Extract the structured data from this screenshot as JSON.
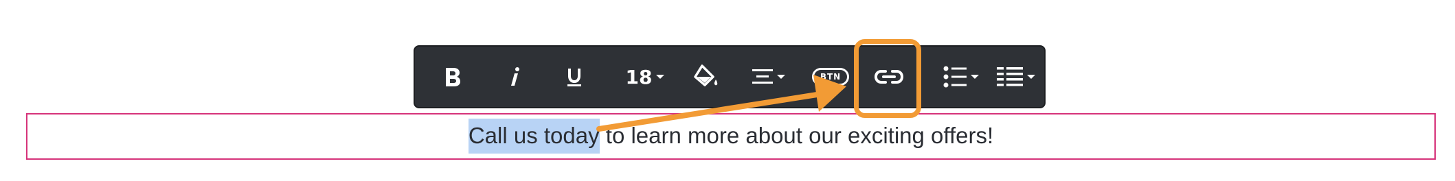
{
  "toolbar": {
    "bold_icon": "bold-icon",
    "italic_icon": "italic-icon",
    "underline_icon": "underline-icon",
    "font_size": "18",
    "fill_icon": "paint-bucket-icon",
    "align_icon": "align-center-icon",
    "button_label": "BTN",
    "link_icon": "link-icon",
    "bullet_list_icon": "bulleted-list-icon",
    "numbered_list_icon": "numbered-list-icon"
  },
  "content": {
    "selected_text": "Call us today",
    "rest_text": " to learn more about our exciting offers!"
  },
  "colors": {
    "toolbar_bg": "#2e3136",
    "highlight": "#f29b35",
    "selection": "#b8d3f5",
    "frame_border": "#d6337a"
  }
}
